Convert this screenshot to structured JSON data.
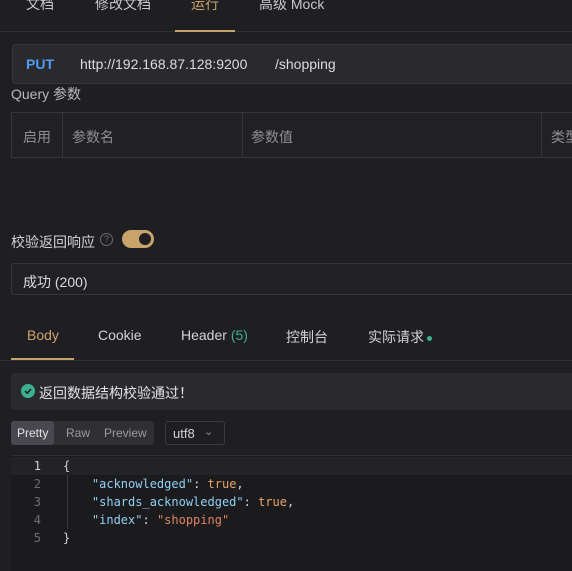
{
  "top_tabs": [
    "文档",
    "修改文档",
    "运行",
    "高级 Mock"
  ],
  "request": {
    "method": "PUT",
    "host": "http://192.168.87.128:9200",
    "path": "/shopping"
  },
  "query": {
    "title": "Query 参数",
    "columns": [
      "启用",
      "参数名",
      "参数值",
      "类型"
    ]
  },
  "validate": {
    "label": "校验返回响应",
    "enabled": true,
    "status": "成功 (200)"
  },
  "response_tabs": {
    "body": "Body",
    "cookie": "Cookie",
    "header": "Header",
    "header_count": "(5)",
    "console": "控制台",
    "actual": "实际请求"
  },
  "banner": "返回数据结构校验通过！",
  "format": {
    "pretty": "Pretty",
    "raw": "Raw",
    "preview": "Preview",
    "encoding": "utf8"
  },
  "code": {
    "line_numbers": [
      "1",
      "2",
      "3",
      "4",
      "5"
    ],
    "open": "{",
    "close": "}",
    "pairs": [
      {
        "key": "\"acknowledged\"",
        "value": "true",
        "comma": ","
      },
      {
        "key": "\"shards_acknowledged\"",
        "value": "true",
        "comma": ","
      },
      {
        "key": "\"index\"",
        "value": "\"shopping\"",
        "comma": ""
      }
    ]
  },
  "colors": {
    "accent": "#c9a46a",
    "success": "#3bb08f",
    "method": "#4f9cf5"
  },
  "icons": {
    "help": "question-circle-icon",
    "check": "check-circle-icon",
    "chevron": "chevron-down-icon"
  }
}
